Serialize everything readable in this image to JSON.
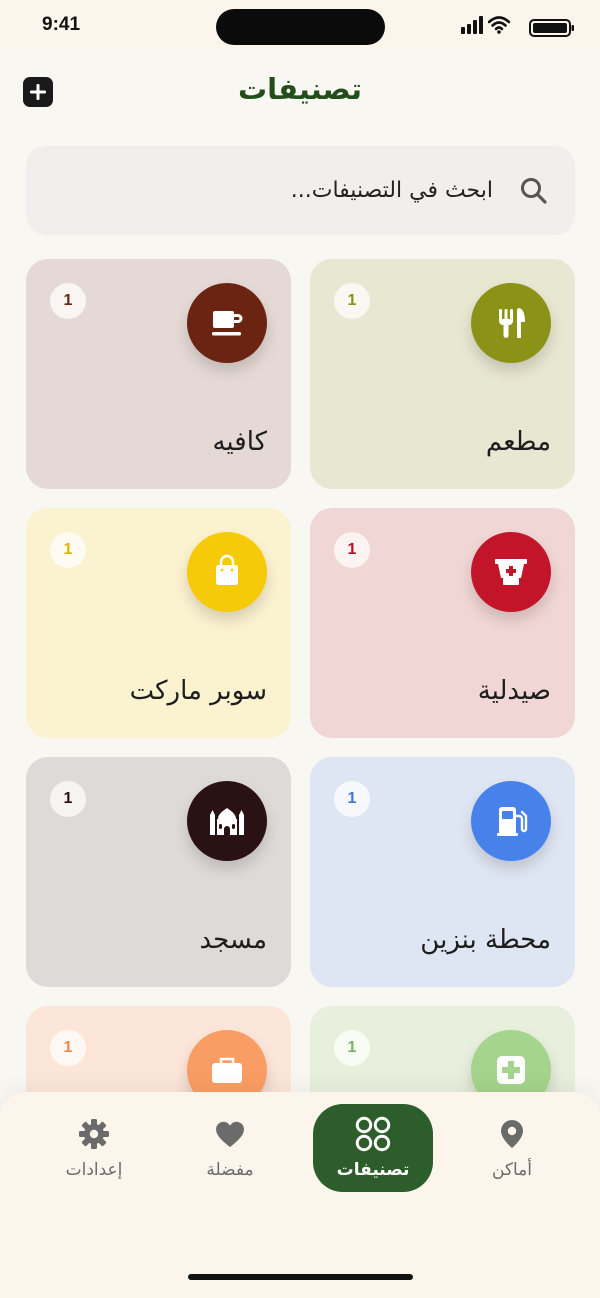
{
  "status_bar": {
    "time": "9:41"
  },
  "header": {
    "title": "تصنيفات"
  },
  "search": {
    "placeholder": "ابحث في التصنيفات..."
  },
  "categories": [
    {
      "label": "مطعم",
      "count": "1",
      "icon": "fork-knife-icon",
      "bg": "#e8e7d1",
      "icon_bg": "#8a9217",
      "count_color": "#8a9217"
    },
    {
      "label": "كافيه",
      "count": "1",
      "icon": "coffee-cup-icon",
      "bg": "#e4d9d4",
      "icon_bg": "#6b2411",
      "count_color": "#6b2411"
    },
    {
      "label": "صيدلية",
      "count": "1",
      "icon": "pharmacy-mortar-icon",
      "bg": "#f0d6d4",
      "icon_bg": "#c3152a",
      "count_color": "#b11226"
    },
    {
      "label": "سوبر ماركت",
      "count": "1",
      "icon": "shopping-bag-icon",
      "bg": "#fbf2d0",
      "icon_bg": "#f6c909",
      "count_color": "#e0b407"
    },
    {
      "label": "محطة بنزين",
      "count": "1",
      "icon": "fuel-pump-icon",
      "bg": "#dfe6f3",
      "icon_bg": "#4782ea",
      "count_color": "#3f76d6"
    },
    {
      "label": "مسجد",
      "count": "1",
      "icon": "mosque-icon",
      "bg": "#dedad7",
      "icon_bg": "#2a1113",
      "count_color": "#2a1113"
    },
    {
      "label": "",
      "count": "1",
      "icon": "medical-cross-icon",
      "bg": "#e8efdc",
      "icon_bg": "#a4d48d",
      "count_color": "#79b267"
    },
    {
      "label": "",
      "count": "1",
      "icon": "briefcase-icon",
      "bg": "#fce6da",
      "icon_bg": "#fa9d64",
      "count_color": "#f08a4a"
    }
  ],
  "nav": {
    "places": "أماكن",
    "categories": "تصنيفات",
    "favorites": "مفضلة",
    "settings": "إعدادات"
  }
}
